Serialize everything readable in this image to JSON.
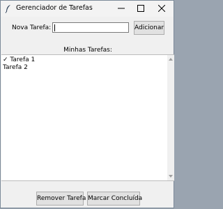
{
  "window": {
    "title": "Gerenciador de Tarefas",
    "icon": "feather-icon"
  },
  "titlebar_buttons": {
    "minimize_icon": "minimize-icon",
    "maximize_icon": "maximize-icon",
    "close_icon": "close-icon"
  },
  "form": {
    "label": "Nova Tarefa:",
    "input_value": "",
    "add_button": "Adicionar"
  },
  "list": {
    "title": "Minhas Tarefas:",
    "items": [
      "✓ Tarefa 1",
      "Tarefa 2"
    ]
  },
  "actions": {
    "remove_button": "Remover Tarefa",
    "complete_button": "Marcar Concluída"
  }
}
